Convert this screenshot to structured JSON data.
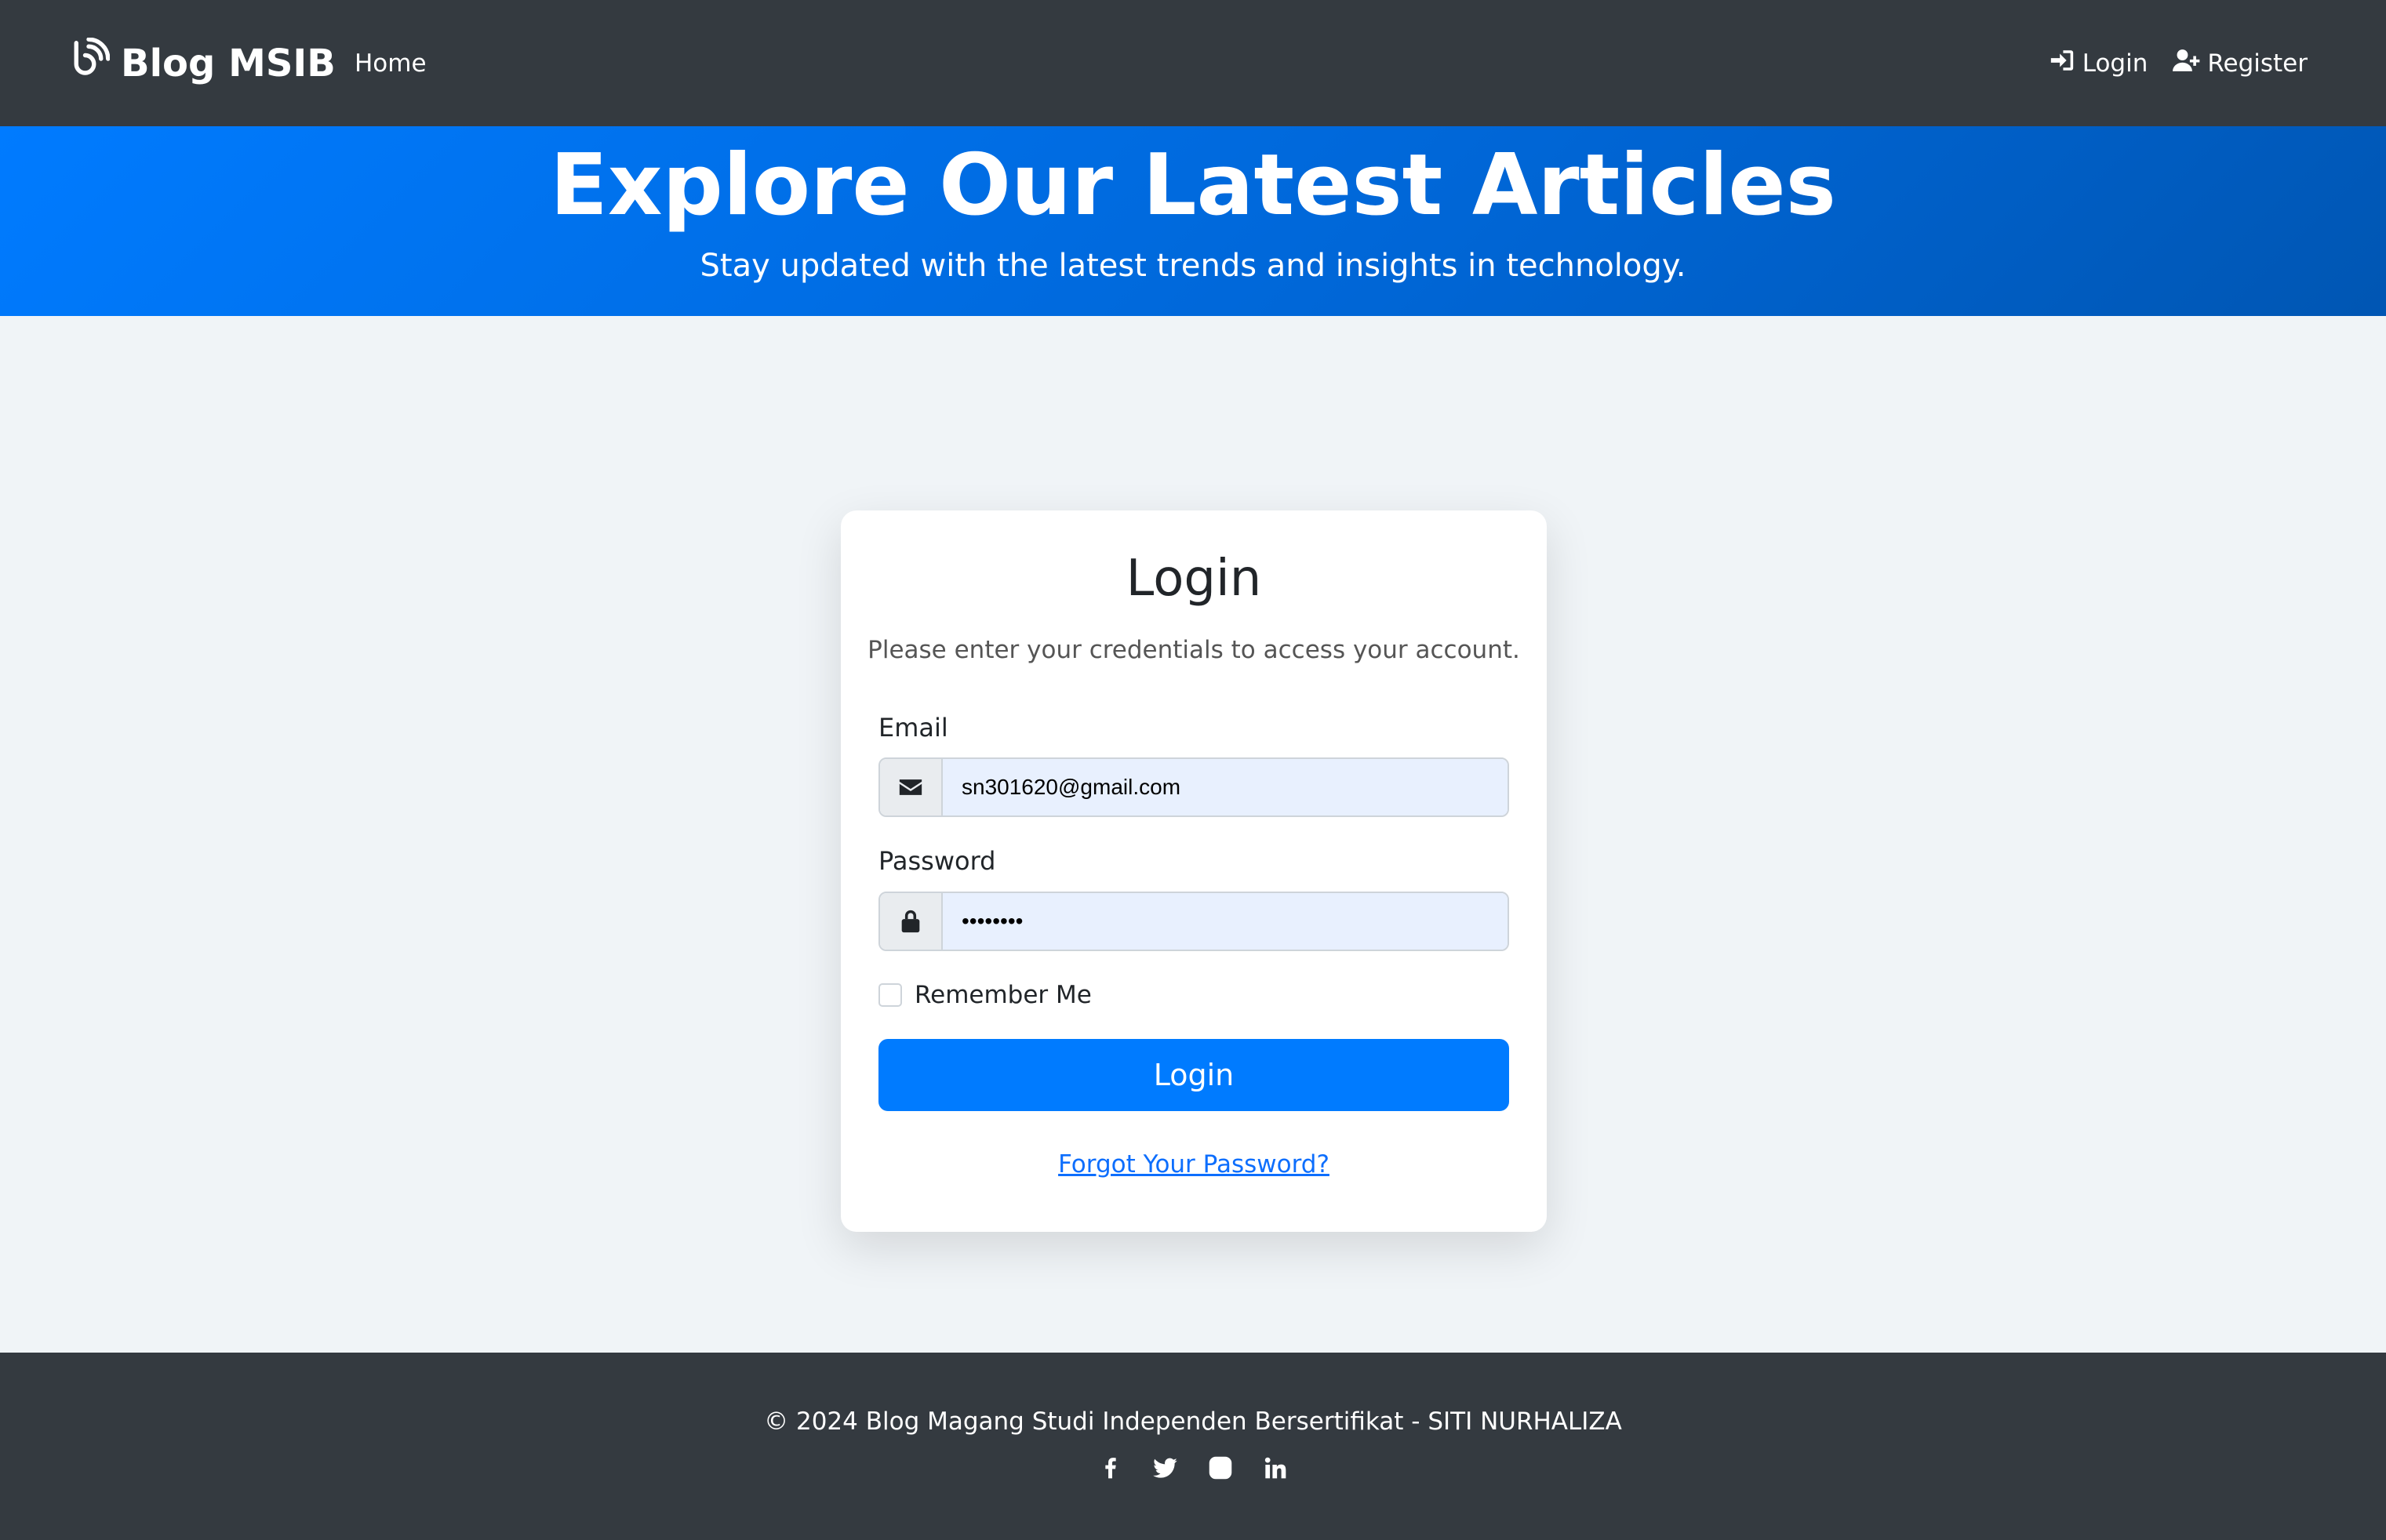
{
  "navbar": {
    "brand": "Blog MSIB",
    "home": "Home",
    "login": "Login",
    "register": "Register"
  },
  "hero": {
    "title": "Explore Our Latest Articles",
    "subtitle": "Stay updated with the latest trends and insights in technology."
  },
  "login_card": {
    "title": "Login",
    "subtitle": "Please enter your credentials to access your account.",
    "email_label": "Email",
    "email_value": "sn301620@gmail.com",
    "password_label": "Password",
    "password_value": "••••••••",
    "remember_label": "Remember Me",
    "submit_label": "Login",
    "forgot_label": "Forgot Your Password?"
  },
  "footer": {
    "copyright": "© 2024 Blog Magang Studi Independen Bersertifikat - SITI NURHALIZA",
    "socials": [
      "facebook-icon",
      "twitter-icon",
      "instagram-icon",
      "linkedin-icon"
    ]
  },
  "colors": {
    "navbar_bg": "#343a40",
    "hero_gradient_start": "#007bff",
    "hero_gradient_end": "#0056b3",
    "primary": "#007bff",
    "page_bg": "#f0f4f7"
  }
}
